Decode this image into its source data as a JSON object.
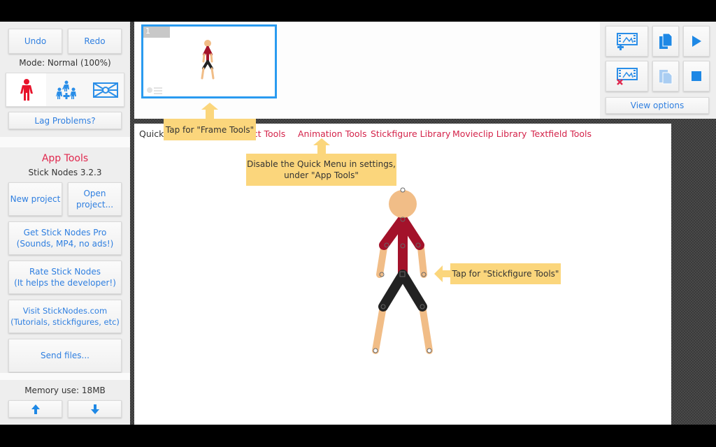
{
  "left_panel": {
    "undo_label": "Undo",
    "redo_label": "Redo",
    "mode_text": "Mode: Normal (100%)",
    "mode_buttons": [
      {
        "name": "single-stickfigure-mode",
        "icon": "stickfigure-icon",
        "color": "#e8132b",
        "active": true
      },
      {
        "name": "multi-stickfigure-mode",
        "icon": "group-stickfigures-icon",
        "color": "#2a8ee8",
        "active": false
      },
      {
        "name": "background-mode",
        "icon": "background-image-icon",
        "color": "#2a8ee8",
        "active": false
      }
    ],
    "lag_label": "Lag Problems?",
    "app_tools_title": "App Tools",
    "version": "Stick Nodes 3.2.3",
    "new_project_label": "New project",
    "open_project_label": "Open project...",
    "get_pro_label": "Get Stick Nodes Pro\n(Sounds, MP4, no ads!)",
    "rate_label": "Rate Stick Nodes\n(It helps the developer!)",
    "visit_label": "Visit StickNodes.com\n(Tutorials, stickfigures, etc)",
    "send_files_label": "Send files...",
    "memory_text": "Memory use: 18MB",
    "up_icon": "arrow-up-icon",
    "down_icon": "arrow-down-icon"
  },
  "frames": [
    {
      "number": "1",
      "selected": true
    }
  ],
  "right_panel": {
    "add_frame_icon": "add-frame-icon",
    "copy_frame_icon": "copy-frame-icon",
    "play_icon": "play-icon",
    "delete_frame_icon": "delete-frame-icon",
    "paste_frame_icon": "paste-frame-icon",
    "stop_icon": "stop-icon",
    "view_options_label": "View options"
  },
  "quick_menu": {
    "prefix": "Quick",
    "items": [
      "Object Tools",
      "Animation Tools",
      "Stickfigure Library",
      "Movieclip Library",
      "Textfield Tools"
    ],
    "visible_partial_first": "ect Tools"
  },
  "tooltips": {
    "frame_tools": "Tap for \"Frame Tools\"",
    "quick_menu": "Disable the Quick Menu in settings,\nunder \"App Tools\"",
    "stickfigure_tools": "Tap for \"Stickfigure Tools\""
  },
  "colors": {
    "accent_blue": "#2f7fe0",
    "menu_red": "#d4234a",
    "tip_yellow": "#fbd67c",
    "frame_border": "#2a9bf0",
    "skin": "#f1bd87",
    "shirt": "#a3122a",
    "pants": "#222222"
  }
}
